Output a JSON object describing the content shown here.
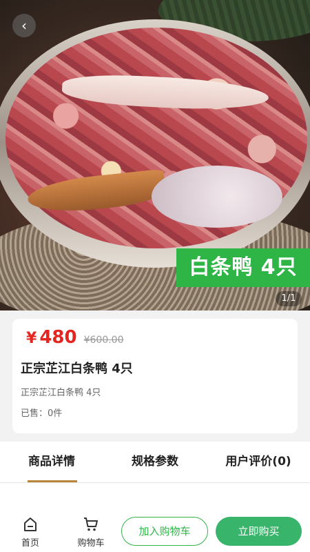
{
  "hero": {
    "back_icon": "chevron-left-icon",
    "banner_text": "白条鸭 4只",
    "pager": "1/1"
  },
  "product": {
    "currency_symbol": "¥",
    "price": "480",
    "original_price": "¥600.00",
    "title": "正宗芷江白条鸭 4只",
    "subtitle": "正宗芷江白条鸭 4只",
    "sold": "已售：0件"
  },
  "tabs": [
    {
      "label": "商品详情",
      "active": true
    },
    {
      "label": "规格参数",
      "active": false
    },
    {
      "label": "用户评价(0)",
      "active": false
    }
  ],
  "bottombar": {
    "home_label": "首页",
    "home_icon": "home-icon",
    "cart_label": "购物车",
    "cart_icon": "cart-icon",
    "add_to_cart": "加入购物车",
    "buy_now": "立即购买"
  },
  "colors": {
    "accent_green": "#2fb546",
    "buy_green": "#38b56a",
    "price_red": "#e5251f",
    "tab_underline": "#b7863a"
  }
}
